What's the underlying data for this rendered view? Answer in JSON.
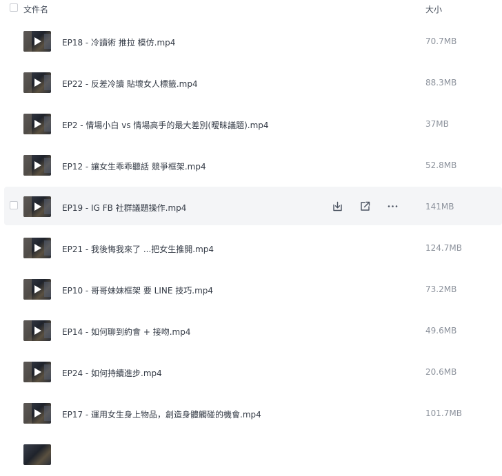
{
  "header": {
    "name_label": "文件名",
    "size_label": "大小"
  },
  "files": [
    {
      "name": "EP18 - 冷讀術 推拉 模仿.mp4",
      "size": "70.7MB"
    },
    {
      "name": "EP22 - 反差冷讀 貼壞女人標籤.mp4",
      "size": "88.3MB"
    },
    {
      "name": "EP2 - 情場小白 vs 情場高手的最大差別(曖昧議題).mp4",
      "size": "37MB"
    },
    {
      "name": "EP12 - 讓女生乖乖聽話 競爭框架.mp4",
      "size": "52.8MB"
    },
    {
      "name": "EP19 - IG FB 社群議題操作.mp4",
      "size": "141MB"
    },
    {
      "name": "EP21 - 我後悔我來了 ...把女生推開.mp4",
      "size": "124.7MB"
    },
    {
      "name": "EP10 - 哥哥妹妹框架 要 LINE 技巧.mp4",
      "size": "73.2MB"
    },
    {
      "name": "EP14 - 如何聊到約會 + 接吻.mp4",
      "size": "49.6MB"
    },
    {
      "name": "EP24 - 如何持續進步.mp4",
      "size": "20.6MB"
    },
    {
      "name": "EP17 - 運用女生身上物品，創造身體觸碰的機會.mp4",
      "size": "101.7MB"
    }
  ],
  "hovered_row": 4,
  "icons": {
    "download": "download-icon",
    "share": "share-icon",
    "more": "more-icon",
    "play": "play-icon"
  },
  "colors": {
    "hover_bg": "#f4f5f7",
    "text": "#333a45",
    "muted": "#8c929c"
  }
}
